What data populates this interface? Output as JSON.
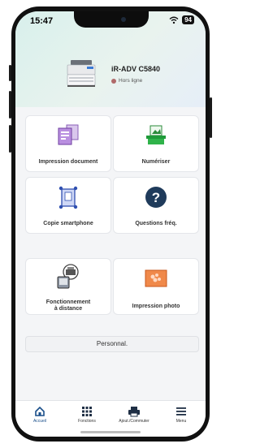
{
  "status_bar": {
    "time": "15:47",
    "battery": "94"
  },
  "printer": {
    "name": "iR-ADV C5840",
    "status": "Hors ligne"
  },
  "tiles": [
    {
      "label": "Impression document"
    },
    {
      "label": "Numériser"
    },
    {
      "label": "Copie smartphone"
    },
    {
      "label": "Questions fréq."
    },
    {
      "label_line1": "Fonctionnement",
      "label_line2": "à distance"
    },
    {
      "label": "Impression photo"
    }
  ],
  "personal_button": "Personnal.",
  "tabbar": {
    "items": [
      {
        "label": "Accueil",
        "icon": "home-icon",
        "active": true
      },
      {
        "label": "Fonctions",
        "icon": "grid-icon"
      },
      {
        "label": "Ajout./Commuter",
        "icon": "printer-icon"
      },
      {
        "label": "Menu",
        "icon": "menu-icon"
      }
    ]
  },
  "colors": {
    "accent": "#1a4f8a",
    "header_gradient": "#d8f0ec",
    "question_icon": "#1f3b5b",
    "photo_icon": "#e8763c"
  }
}
